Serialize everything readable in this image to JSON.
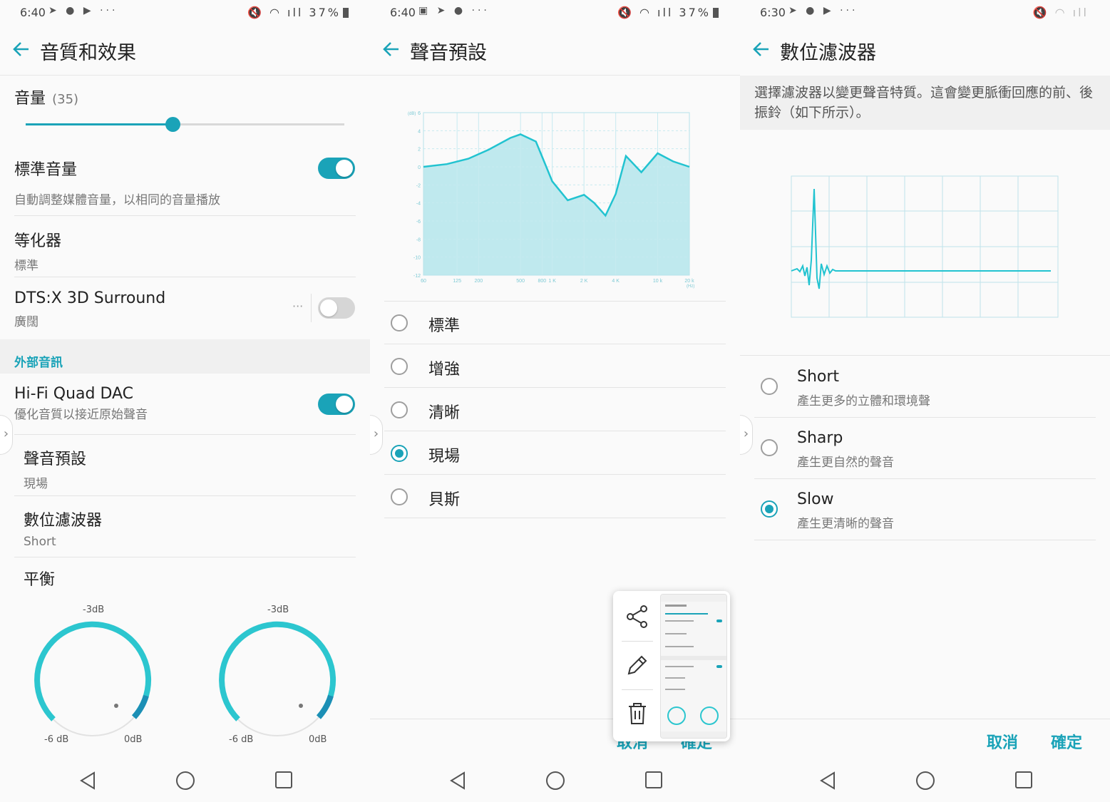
{
  "colors": {
    "accent": "#1aa3b8",
    "chart_fill": "#bfe9ee",
    "chart_line": "#22c3d0"
  },
  "panel1": {
    "status": {
      "time": "6:40",
      "icons": "➤ ● ▶ ···",
      "right": "🔇 ◠ ıll 37%"
    },
    "title": "音質和效果",
    "volume": {
      "label": "音量",
      "value_text": "(35)",
      "level_fraction": 0.46
    },
    "standard_volume": {
      "title": "標準音量",
      "subtitle": "自動調整媒體音量，以相同的音量播放",
      "on": true
    },
    "equalizer": {
      "title": "等化器",
      "subtitle": "標準"
    },
    "dts": {
      "title": "DTS:X 3D Surround",
      "subtitle": "廣闊",
      "more": "···",
      "on": false
    },
    "section_external": "外部音訊",
    "hifi": {
      "title": "Hi-Fi Quad DAC",
      "subtitle": "優化音質以接近原始聲音",
      "on": true
    },
    "sound_preset": {
      "title": "聲音預設",
      "subtitle": "現場"
    },
    "digital_filter": {
      "title": "數位濾波器",
      "subtitle": "Short"
    },
    "balance": {
      "title": "平衡",
      "dials": [
        {
          "top": "-3dB",
          "left": "-6 dB",
          "right": "0dB"
        },
        {
          "top": "-3dB",
          "left": "-6 dB",
          "right": "0dB"
        }
      ]
    }
  },
  "panel2": {
    "status": {
      "time": "6:40",
      "icons": "▣ ➤ ● ···",
      "right": "🔇 ◠ ıll 37%"
    },
    "title": "聲音預設",
    "chart_data": {
      "type": "area",
      "y_unit": "(dB)",
      "x_unit": "(Hz)",
      "y_ticks": [
        "6",
        "4",
        "2",
        "0",
        "-2",
        "-4",
        "-6",
        "-8",
        "-10",
        "-12"
      ],
      "x_ticks": [
        "60",
        "125",
        "200",
        "500",
        "800",
        "1 K",
        "2 K",
        "4 K",
        "10 k",
        "20 k"
      ],
      "ylim": [
        -12,
        6
      ],
      "x": [
        60,
        100,
        160,
        250,
        400,
        500,
        700,
        1000,
        1400,
        2000,
        2500,
        3200,
        4000,
        5000,
        7000,
        10000,
        14000,
        20000
      ],
      "y": [
        0.0,
        0.3,
        0.9,
        1.9,
        3.2,
        3.6,
        2.8,
        -1.6,
        -3.7,
        -3.1,
        -4.0,
        -5.4,
        -3.0,
        1.2,
        -0.6,
        1.5,
        0.6,
        0.0
      ]
    },
    "options": [
      {
        "label": "標準",
        "selected": false
      },
      {
        "label": "增強",
        "selected": false
      },
      {
        "label": "清晰",
        "selected": false
      },
      {
        "label": "現場",
        "selected": true
      },
      {
        "label": "貝斯",
        "selected": false
      }
    ],
    "cancel": "取消",
    "ok": "確定",
    "popup": {
      "share_icon": "share-icon",
      "edit_icon": "pencil-icon",
      "delete_icon": "trash-icon"
    }
  },
  "panel3": {
    "status": {
      "time": "6:30",
      "icons": "➤ ● ▶ ···",
      "right": "🔇 ◠ ıll"
    },
    "title": "數位濾波器",
    "description": "選擇濾波器以變更聲音特質。這會變更脈衝回應的前、後振鈴（如下所示）。",
    "options": [
      {
        "name": "Short",
        "desc": "產生更多的立體和環境聲",
        "selected": false
      },
      {
        "name": "Sharp",
        "desc": "產生更自然的聲音",
        "selected": false
      },
      {
        "name": "Slow",
        "desc": "產生更清晰的聲音",
        "selected": true
      }
    ],
    "cancel": "取消",
    "ok": "確定"
  }
}
